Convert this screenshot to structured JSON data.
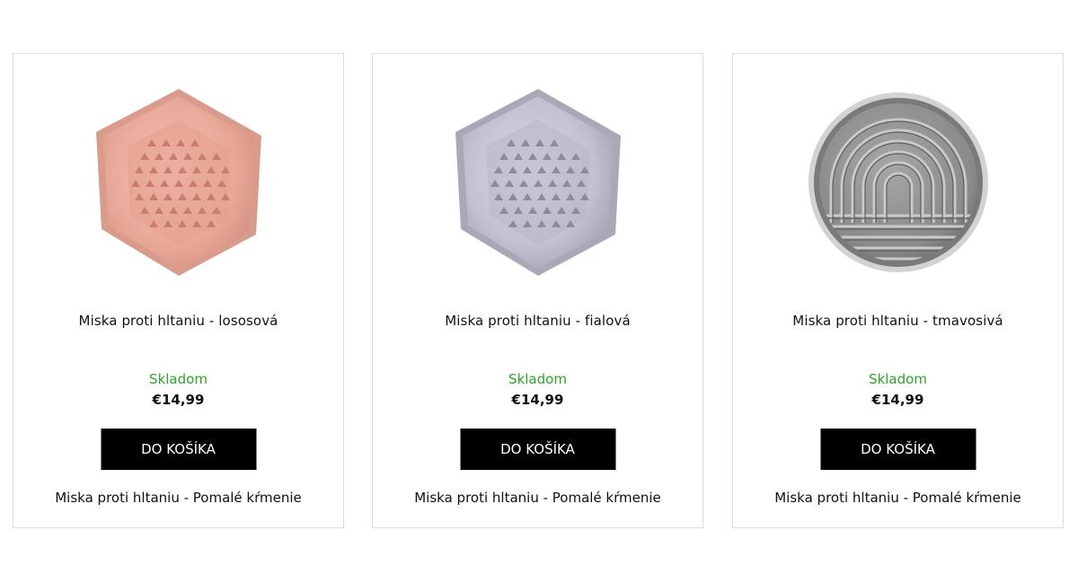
{
  "products": [
    {
      "name": "Miska proti hltaniu - lososová",
      "stock": "Skladom",
      "price": "€14,99",
      "button_label": "DO KOŠÍKA",
      "subtitle": "Miska proti hltaniu - Pomalé kŕmenie",
      "image_icon": "hexagon-slow-feeder-bowl",
      "color": "#e8a898"
    },
    {
      "name": "Miska proti hltaniu - fialová",
      "stock": "Skladom",
      "price": "€14,99",
      "button_label": "DO KOŠÍKA",
      "subtitle": "Miska proti hltaniu - Pomalé kŕmenie",
      "image_icon": "hexagon-slow-feeder-bowl",
      "color": "#b9b8c6"
    },
    {
      "name": "Miska proti hltaniu - tmavosivá",
      "stock": "Skladom",
      "price": "€14,99",
      "button_label": "DO KOŠÍKA",
      "subtitle": "Miska proti hltaniu - Pomalé kŕmenie",
      "image_icon": "round-rainbow-slow-feeder-bowl",
      "color": "#8c8c8c"
    }
  ],
  "colors": {
    "stock_green": "#2aa52a",
    "button_bg": "#000000",
    "card_border": "#dddddd"
  }
}
